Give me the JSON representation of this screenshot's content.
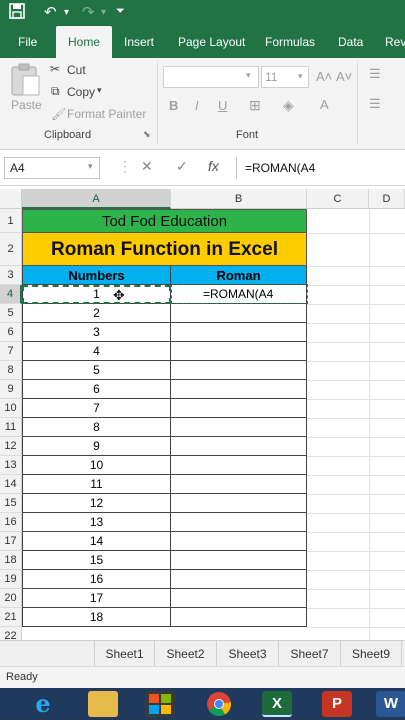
{
  "quick_access": {
    "save_icon": "save-icon",
    "undo_icon": "undo-icon",
    "redo_icon": "redo-icon",
    "customize_icon": "chevron-down-icon"
  },
  "ribbon_tabs": [
    "File",
    "Home",
    "Insert",
    "Page Layout",
    "Formulas",
    "Data",
    "Rev"
  ],
  "active_tab": "Home",
  "clipboard": {
    "paste": "Paste",
    "cut": "Cut",
    "copy": "Copy",
    "format_painter": "Format Painter",
    "group_label": "Clipboard"
  },
  "font": {
    "size": "11",
    "bold": "B",
    "italic": "I",
    "underline": "U",
    "grow": "A˄",
    "shrink": "A˅",
    "group_label": "Font"
  },
  "formula_bar": {
    "name_box": "A4",
    "cancel": "✕",
    "enter": "✓",
    "fx": "fx",
    "content": "=ROMAN(A4"
  },
  "columns": [
    "A",
    "B",
    "C",
    "D"
  ],
  "sheet": {
    "title": "Tod Fod Education",
    "subtitle": "Roman Function in Excel",
    "header_numbers": "Numbers",
    "header_roman": "Roman",
    "row_numbers": [
      "1",
      "2",
      "3",
      "4",
      "5",
      "6",
      "7",
      "8",
      "9",
      "10",
      "11",
      "12",
      "13",
      "14",
      "15",
      "16",
      "17",
      "18",
      "19",
      "20",
      "21",
      "22"
    ],
    "numbers": [
      "1",
      "2",
      "3",
      "4",
      "5",
      "6",
      "7",
      "8",
      "9",
      "10",
      "11",
      "12",
      "13",
      "14",
      "15",
      "16",
      "17",
      "18"
    ],
    "editing_cell": "=ROMAN(A4"
  },
  "sheet_tabs": [
    "Sheet1",
    "Sheet2",
    "Sheet3",
    "Sheet7",
    "Sheet9"
  ],
  "status": "Ready",
  "colors": {
    "excel_green": "#217346",
    "title_fill": "#2db34a",
    "subtitle_fill": "#ffcc00",
    "header_fill": "#00b0f0"
  }
}
